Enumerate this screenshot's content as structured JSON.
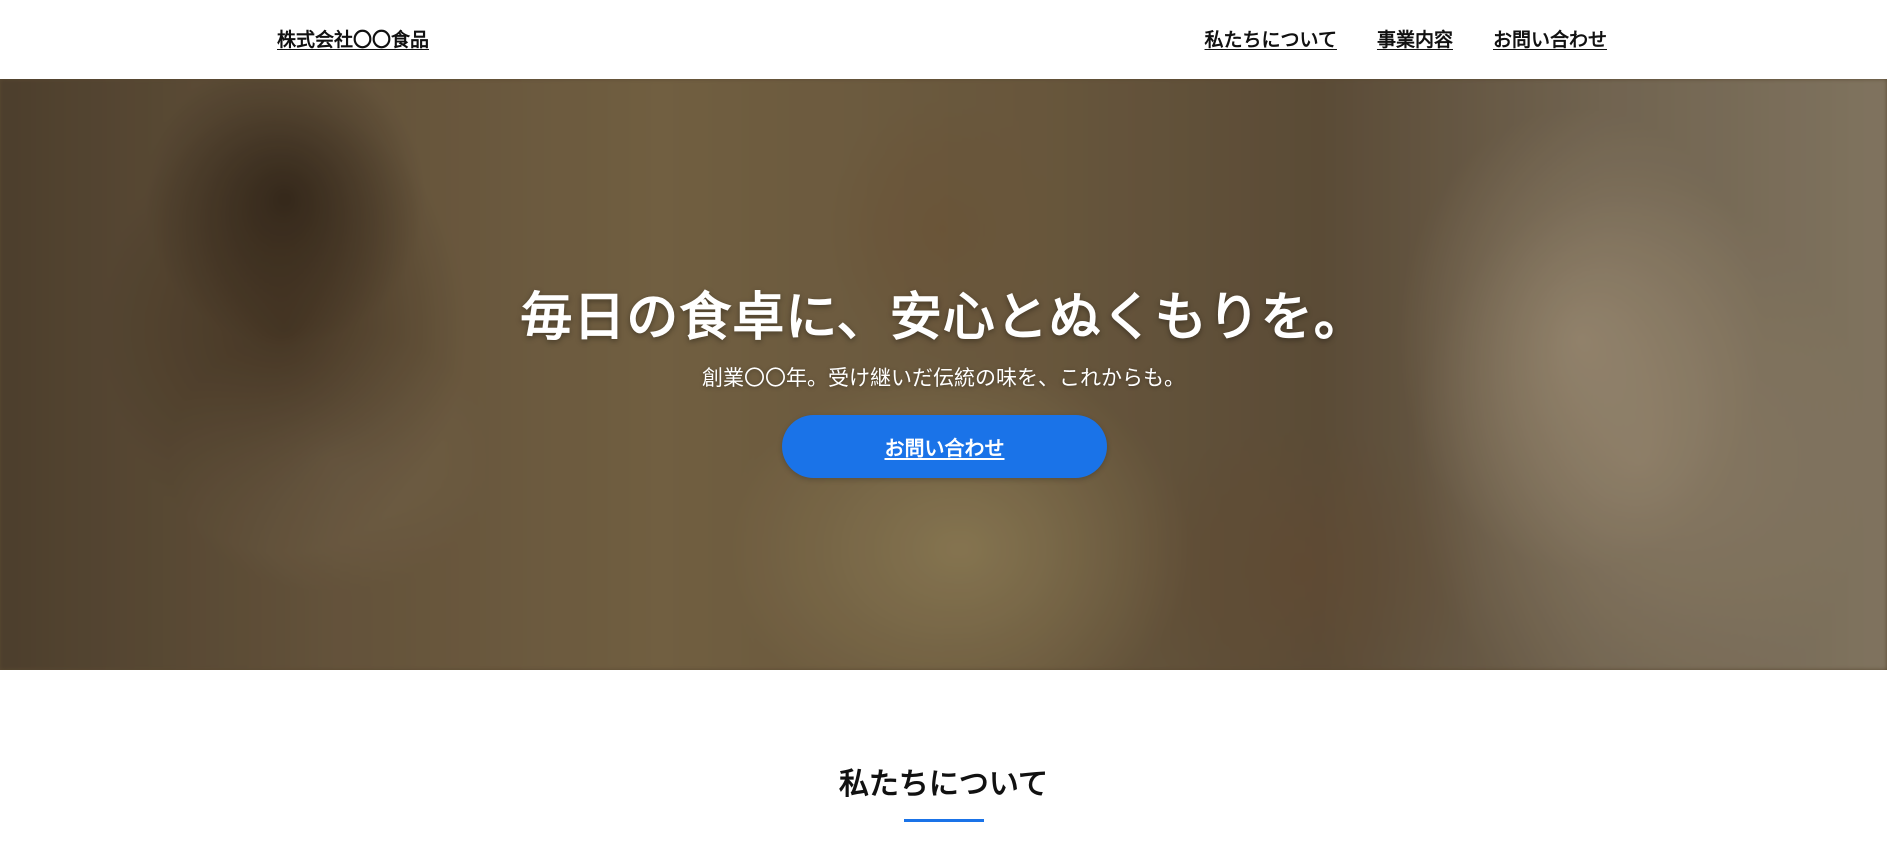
{
  "header": {
    "logo": "株式会社〇〇食品",
    "nav": [
      {
        "label": "私たちについて"
      },
      {
        "label": "事業内容"
      },
      {
        "label": "お問い合わせ"
      }
    ]
  },
  "hero": {
    "title": "毎日の食卓に、安心とぬくもりを。",
    "subtitle": "創業〇〇年。受け継いだ伝統の味を、これからも。",
    "cta_label": "お問い合わせ"
  },
  "about": {
    "title": "私たちについて"
  },
  "colors": {
    "accent": "#1a73e8",
    "text": "#111111",
    "background": "#ffffff"
  }
}
